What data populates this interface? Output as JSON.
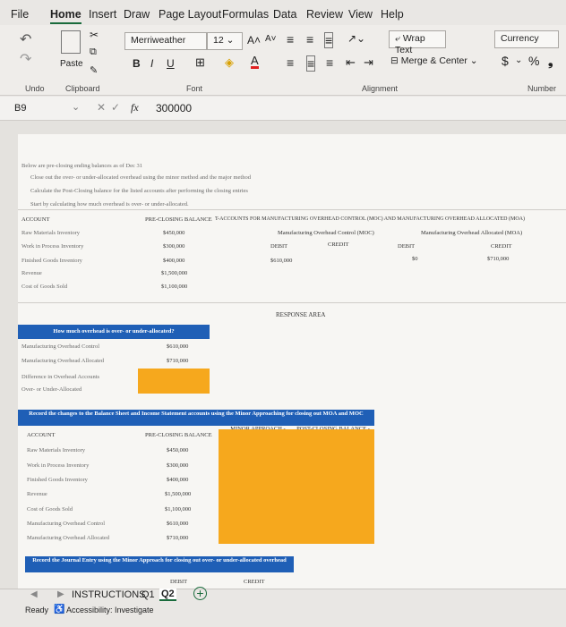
{
  "menu": {
    "file": "File",
    "home": "Home",
    "insert": "Insert",
    "draw": "Draw",
    "page_layout": "Page Layout",
    "formulas": "Formulas",
    "data": "Data",
    "review": "Review",
    "view": "View",
    "help": "Help"
  },
  "ribbon": {
    "paste": "Paste",
    "font_name": "Merriweather",
    "font_size": "12",
    "bold": "B",
    "italic": "I",
    "underline": "U",
    "wrap_text": "Wrap Text",
    "merge_center": "Merge & Center",
    "number_format": "Currency",
    "dollar": "$",
    "percent": "%",
    "groups": {
      "undo": "Undo",
      "clipboard": "Clipboard",
      "font": "Font",
      "alignment": "Alignment",
      "number": "Number"
    }
  },
  "formula_bar": {
    "name_box": "B9",
    "fx": "fx",
    "value": "300000"
  },
  "intro": [
    "Below are pre-closing ending balances as of Dec 31",
    "Close out the over- or under-allocated overhead using the minor method and the major method",
    "Calculate the Post-Closing balance for the listed accounts after performing the closing entries",
    "Start by calculating how much overhead is over- or under-allocated."
  ],
  "top_table": {
    "header_account": "ACCOUNT",
    "header_balance": "PRE-CLOSING BALANCE",
    "t_title": "T-ACCOUNTS FOR MANUFACTURING OVERHEAD CONTROL (MOC) AND MANUFACTURING OVERHEAD ALLOCATED (MOA)",
    "moc": "Manufacturing Overhead Control (MOC)",
    "moa": "Manufacturing Overhead Allocated (MOA)",
    "debit": "DEBIT",
    "credit": "CREDIT",
    "moc_debit": "$610,000",
    "moa_debit": "$0",
    "moa_credit": "$710,000",
    "rows": [
      {
        "account": "Raw Materials Inventory",
        "balance": "$450,000"
      },
      {
        "account": "Work in Process Inventory",
        "balance": "$300,000"
      },
      {
        "account": "Finished Goods Inventory",
        "balance": "$400,000"
      },
      {
        "account": "Revenue",
        "balance": "$1,500,000"
      },
      {
        "account": "Cost of Goods Sold",
        "balance": "$1,100,000"
      }
    ],
    "response": "RESPONSE AREA"
  },
  "over_under": {
    "title": "How much overhead is over- or under-allocated?",
    "rows": [
      {
        "label": "Manufacturing Overhead Control",
        "value": "$610,000"
      },
      {
        "label": "Manufacturing Overhead Allocated",
        "value": "$710,000"
      },
      {
        "label": "Difference in Overhead Accounts",
        "value": ""
      },
      {
        "label": "Over- or Under-Allocated",
        "value": ""
      }
    ]
  },
  "minor": {
    "title": "Record the changes to the Balance Sheet and Income Statement accounts using the Minor Approaching for closing out MOA and MOC",
    "col_account": "ACCOUNT",
    "col_balance": "PRE-CLOSING BALANCE",
    "col_change": "MINOR APPROACH - AMOUNT CHANGE",
    "col_post": "POST-CLOSING BALANCE - MINOR APPROACH",
    "rows": [
      {
        "account": "Raw Materials Inventory",
        "balance": "$450,000"
      },
      {
        "account": "Work in Process Inventory",
        "balance": "$300,000"
      },
      {
        "account": "Finished Goods Inventory",
        "balance": "$400,000"
      },
      {
        "account": "Revenue",
        "balance": "$1,500,000"
      },
      {
        "account": "Cost of Goods Sold",
        "balance": "$1,100,000"
      },
      {
        "account": "Manufacturing Overhead Control",
        "balance": "$610,000"
      },
      {
        "account": "Manufacturing Overhead Allocated",
        "balance": "$710,000"
      }
    ]
  },
  "journal": {
    "title": "Record the Journal Entry using the Minor Approach for closing out over- or under-allocated overhead",
    "debit": "DEBIT",
    "credit": "CREDIT"
  },
  "tabs": {
    "instructions": "INSTRUCTIONS",
    "q1": "Q1",
    "q2": "Q2",
    "add": "+"
  },
  "status": {
    "ready": "Ready",
    "accessibility": "Accessibility: Investigate"
  },
  "colors": {
    "accent": "#1a6b3c",
    "blue": "#1f5fb6",
    "orange": "#f6a81d"
  }
}
